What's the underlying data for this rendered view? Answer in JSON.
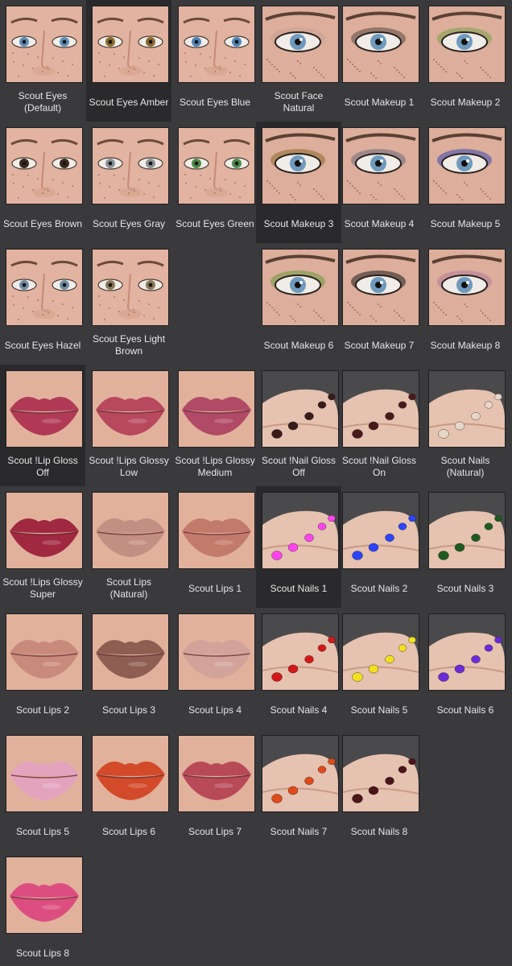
{
  "left_tiles": [
    {
      "label": "Scout Eyes (Default)",
      "kind": "eyes",
      "color": "#5f8fb8",
      "selected": false
    },
    {
      "label": "Scout Eyes Amber",
      "kind": "eyes",
      "color": "#8a6a2a",
      "selected": true
    },
    {
      "label": "Scout Eyes Blue",
      "kind": "eyes",
      "color": "#4f86b8",
      "selected": false
    },
    {
      "label": "Scout Eyes Brown",
      "kind": "eyes",
      "color": "#3a2a22",
      "selected": false
    },
    {
      "label": "Scout Eyes Gray",
      "kind": "eyes",
      "color": "#8a9296",
      "selected": false
    },
    {
      "label": "Scout Eyes Green",
      "kind": "eyes",
      "color": "#4f8a4c",
      "selected": false
    },
    {
      "label": "Scout Eyes Hazel",
      "kind": "eyes",
      "color": "#6f8ea6",
      "selected": false
    },
    {
      "label": "Scout Eyes Light Brown",
      "kind": "eyes",
      "color": "#8a7a5a",
      "selected": false
    },
    null,
    {
      "label": "Scout !Lip Gloss Off",
      "kind": "lips",
      "color": "#b03a55",
      "selected": true
    },
    {
      "label": "Scout !Lips Glossy Low",
      "kind": "lips",
      "color": "#b8485e",
      "selected": false
    },
    {
      "label": "Scout !Lips Glossy Medium",
      "kind": "lips",
      "color": "#b04a66",
      "selected": false
    },
    {
      "label": "Scout !Lips Glossy Super",
      "kind": "lips",
      "color": "#a02840",
      "selected": false
    },
    {
      "label": "Scout Lips (Natural)",
      "kind": "lips",
      "color": "#c28f82",
      "selected": false
    },
    {
      "label": "Scout Lips 1",
      "kind": "lips",
      "color": "#c27a6a",
      "selected": false
    },
    {
      "label": "Scout Lips 2",
      "kind": "lips",
      "color": "#c88a7a",
      "selected": false
    },
    {
      "label": "Scout Lips 3",
      "kind": "lips",
      "color": "#8e5e52",
      "selected": false
    },
    {
      "label": "Scout Lips 4",
      "kind": "lips",
      "color": "#d2a39a",
      "selected": false
    },
    {
      "label": "Scout Lips 5",
      "kind": "lips",
      "color": "#e3a3bd",
      "selected": false
    },
    {
      "label": "Scout Lips 6",
      "kind": "lips",
      "color": "#d24a2a",
      "selected": false
    },
    {
      "label": "Scout Lips 7",
      "kind": "lips",
      "color": "#b84a58",
      "selected": false
    },
    {
      "label": "Scout Lips 8",
      "kind": "lips",
      "color": "#dc4e80",
      "selected": false
    }
  ],
  "right_tiles": [
    {
      "label": "Scout Face Natural",
      "kind": "makeup",
      "color": "#c8a090",
      "selected": false
    },
    {
      "label": "Scout Makeup 1",
      "kind": "makeup",
      "color": "#5a4a42",
      "selected": false
    },
    {
      "label": "Scout Makeup 2",
      "kind": "makeup",
      "color": "#7aa24a",
      "selected": false
    },
    {
      "label": "Scout Makeup 3",
      "kind": "makeup",
      "color": "#8a6a2a",
      "selected": true
    },
    {
      "label": "Scout Makeup 4",
      "kind": "makeup",
      "color": "#6a6a7a",
      "selected": false
    },
    {
      "label": "Scout Makeup 5",
      "kind": "makeup",
      "color": "#3a4ab0",
      "selected": false
    },
    {
      "label": "Scout Makeup 6",
      "kind": "makeup",
      "color": "#6a9a3a",
      "selected": false
    },
    {
      "label": "Scout Makeup 7",
      "kind": "makeup",
      "color": "#1e1e1e",
      "selected": false
    },
    {
      "label": "Scout Makeup 8",
      "kind": "makeup",
      "color": "#b07a9a",
      "selected": false
    },
    {
      "label": "Scout !Nail Gloss Off",
      "kind": "nails",
      "color": "#3a1a1a",
      "selected": false
    },
    {
      "label": "Scout !Nail Gloss On",
      "kind": "nails",
      "color": "#4a1a1a",
      "selected": false
    },
    {
      "label": "Scout Nails (Natural)",
      "kind": "nails",
      "color": "#e8d6c8",
      "selected": false
    },
    {
      "label": "Scout Nails 1",
      "kind": "nails",
      "color": "#ff44ee",
      "selected": true
    },
    {
      "label": "Scout Nails 2",
      "kind": "nails",
      "color": "#2a44ff",
      "selected": false
    },
    {
      "label": "Scout Nails 3",
      "kind": "nails",
      "color": "#1f5a1f",
      "selected": false
    },
    {
      "label": "Scout Nails 4",
      "kind": "nails",
      "color": "#d41818",
      "selected": false
    },
    {
      "label": "Scout Nails 5",
      "kind": "nails",
      "color": "#f2e020",
      "selected": false
    },
    {
      "label": "Scout Nails 6",
      "kind": "nails",
      "color": "#6a2ad8",
      "selected": false
    },
    {
      "label": "Scout Nails 7",
      "kind": "nails",
      "color": "#e04a1a",
      "selected": false
    },
    {
      "label": "Scout Nails 8",
      "kind": "nails",
      "color": "#4a1418",
      "selected": false
    }
  ],
  "colors": {
    "background": "#3a3a3d",
    "selected_tile": "#2a2a2c",
    "label_text": "#e6e6e6",
    "skin": "#e8b9a2",
    "nail_bg": "#4a4a4c"
  }
}
